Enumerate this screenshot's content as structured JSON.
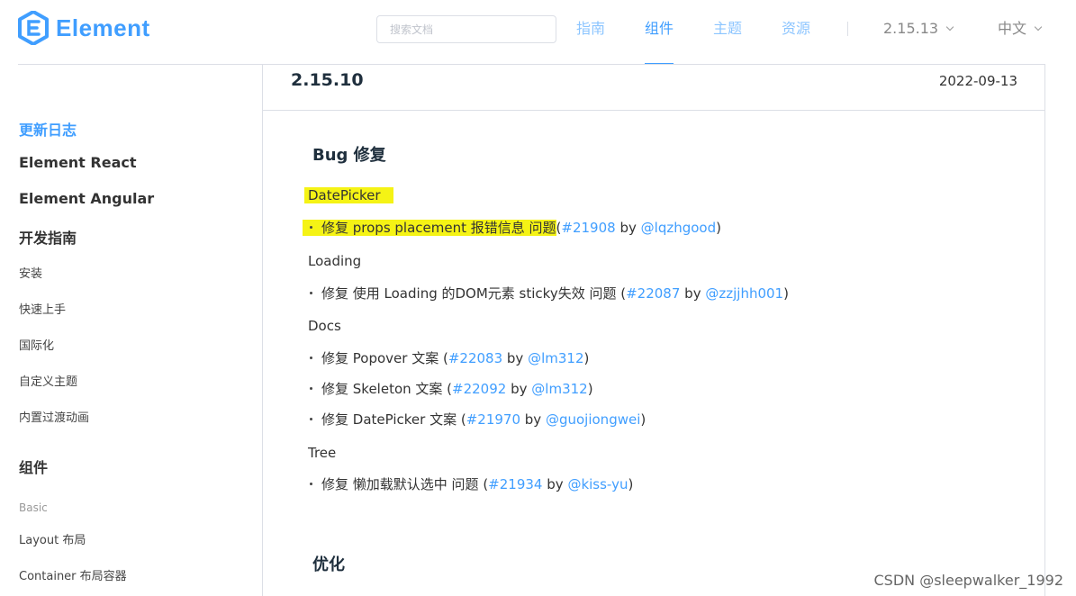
{
  "header": {
    "logo_text": "Element",
    "search_placeholder": "搜索文档",
    "nav": [
      "指南",
      "组件",
      "主题",
      "资源"
    ],
    "version_selector": "2.15.13",
    "language_selector": "中文"
  },
  "sidebar": {
    "main_items": [
      "更新日志",
      "Element React",
      "Element Angular",
      "开发指南"
    ],
    "guide_items": [
      "安装",
      "快速上手",
      "国际化",
      "自定义主题",
      "内置过渡动画"
    ],
    "components_heading": "组件",
    "group_basic": "Basic",
    "component_items": [
      "Layout 布局",
      "Container 布局容器"
    ]
  },
  "release": {
    "version": "2.15.10",
    "date": "2022-09-13",
    "bugfix_heading": "Bug 修复",
    "optimization_heading": "优化",
    "sections": [
      {
        "category": "DatePicker",
        "items": [
          {
            "text": "修复 props placement 报错信息 问题",
            "pr": "#21908",
            "by": "by",
            "author": "@lqzhgood"
          }
        ]
      },
      {
        "category": "Loading",
        "items": [
          {
            "text": "修复 使用 Loading 的DOM元素 sticky失效 问题",
            "pr": "#22087",
            "by": "by",
            "author": "@zzjjhh001"
          }
        ]
      },
      {
        "category": "Docs",
        "items": [
          {
            "text": "修复 Popover 文案",
            "pr": "#22083",
            "by": "by",
            "author": "@lm312"
          },
          {
            "text": "修复 Skeleton 文案",
            "pr": "#22092",
            "by": "by",
            "author": "@lm312"
          },
          {
            "text": "修复 DatePicker 文案",
            "pr": "#21970",
            "by": "by",
            "author": "@guojiongwei"
          }
        ]
      },
      {
        "category": "Tree",
        "items": [
          {
            "text": "修复 懒加载默认选中 问题",
            "pr": "#21934",
            "by": "by",
            "author": "@kiss-yu"
          }
        ]
      }
    ]
  },
  "watermark": "CSDN @sleepwalker_1992",
  "colors": {
    "accent": "#409eff",
    "highlight": "#f5f315",
    "border": "#dcdfe6"
  }
}
